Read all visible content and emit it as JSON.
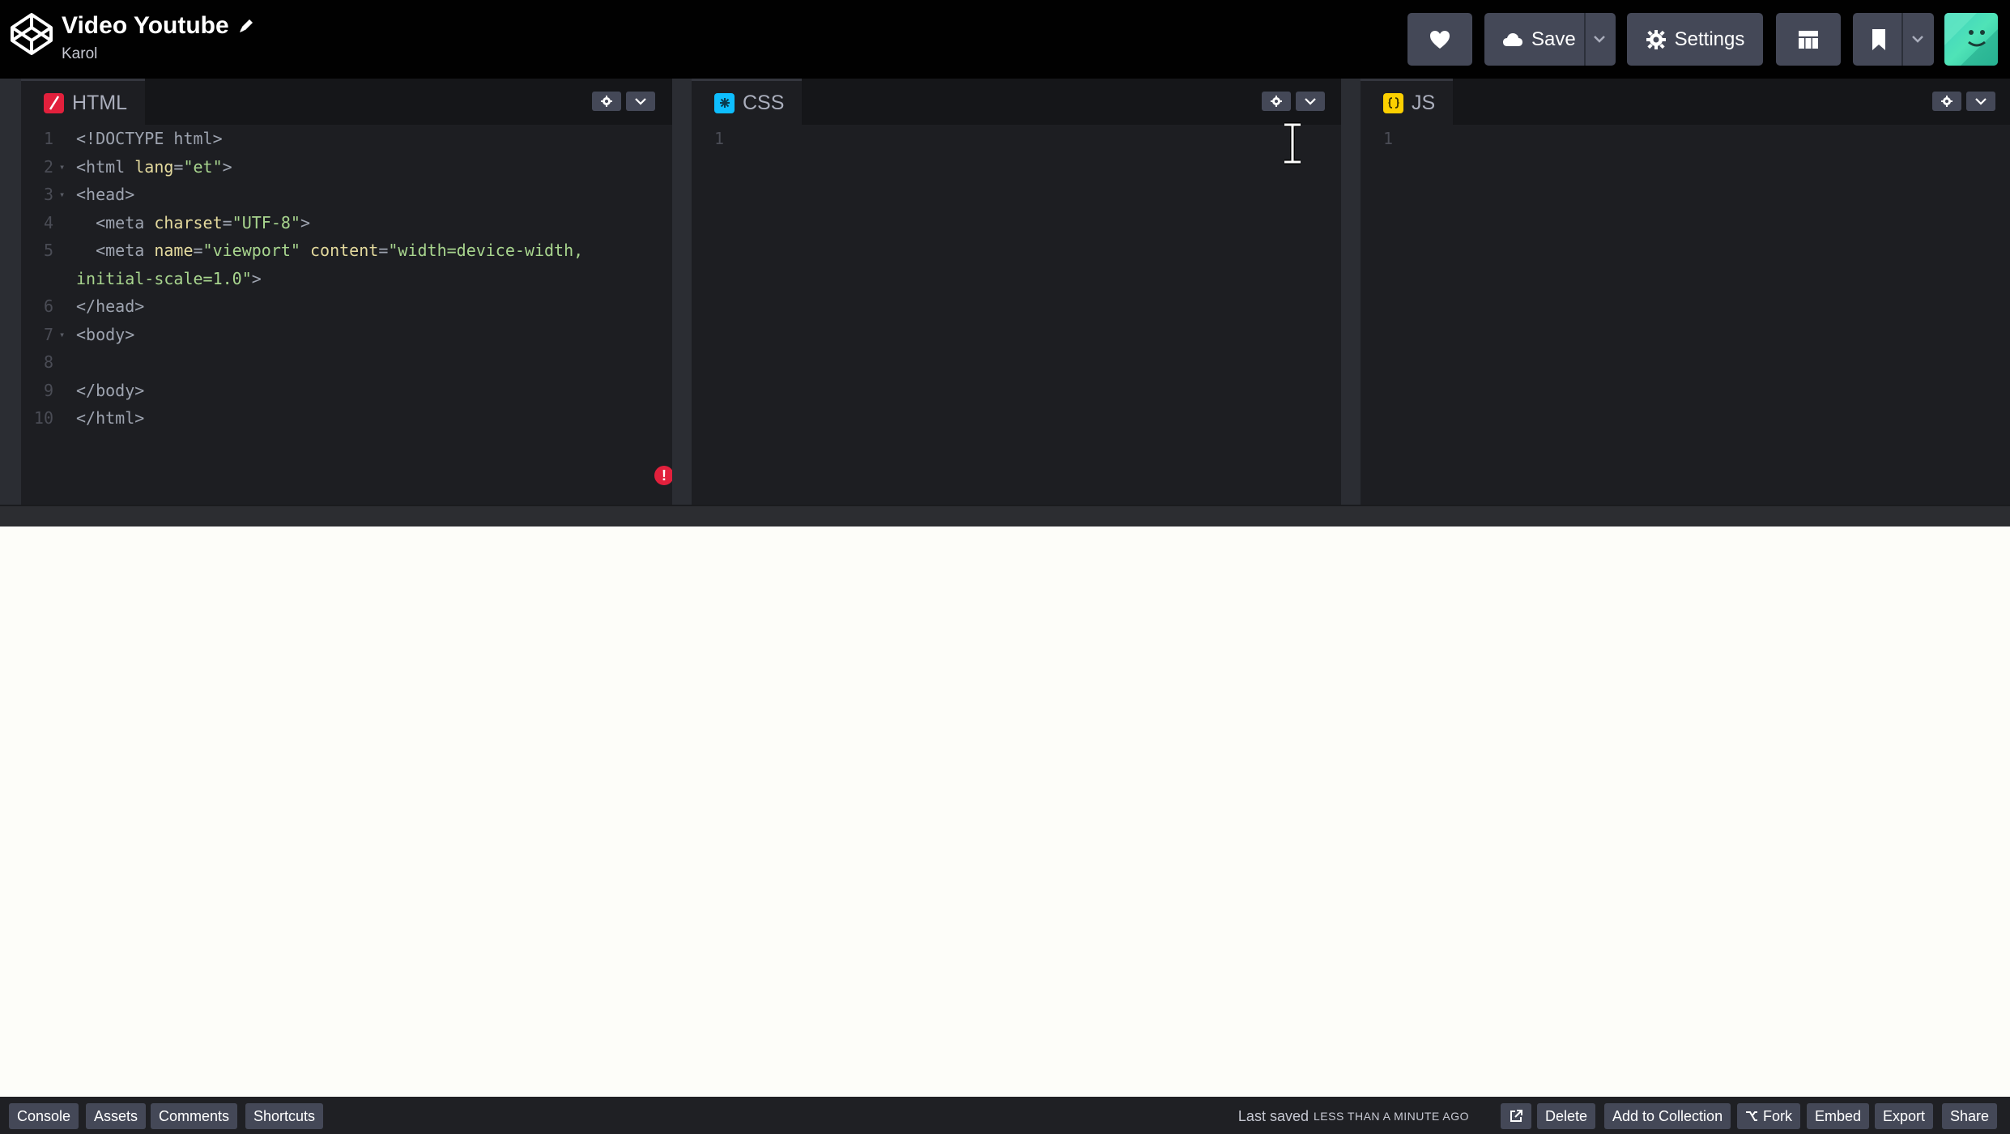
{
  "header": {
    "pen_title": "Video Youtube",
    "author": "Karol",
    "save_label": "Save",
    "settings_label": "Settings",
    "icons": [
      "codepen-logo-icon",
      "pencil-icon",
      "heart-icon",
      "cloud-icon",
      "chevron-down-icon",
      "gear-icon",
      "layout-icon",
      "bookmark-icon",
      "avatar"
    ]
  },
  "editors": {
    "html": {
      "label": "HTML",
      "icon_color": "#e2203c",
      "lines": [
        {
          "n": "1",
          "parts": [
            {
              "c": "t-doc",
              "t": "<!DOCTYPE html>"
            }
          ]
        },
        {
          "n": "2",
          "fold": true,
          "parts": [
            {
              "c": "t-tag",
              "t": "<html "
            },
            {
              "c": "t-attr",
              "t": "lang"
            },
            {
              "c": "t-tag",
              "t": "="
            },
            {
              "c": "t-str",
              "t": "\"et\""
            },
            {
              "c": "t-tag",
              "t": ">"
            }
          ]
        },
        {
          "n": "3",
          "fold": true,
          "parts": [
            {
              "c": "t-tag",
              "t": "<head>"
            }
          ]
        },
        {
          "n": "4",
          "parts": [
            {
              "c": "t-tag",
              "t": "  <meta "
            },
            {
              "c": "t-attr",
              "t": "charset"
            },
            {
              "c": "t-tag",
              "t": "="
            },
            {
              "c": "t-str",
              "t": "\"UTF-8\""
            },
            {
              "c": "t-tag",
              "t": ">"
            }
          ]
        },
        {
          "n": "5",
          "parts": [
            {
              "c": "t-tag",
              "t": "  <meta "
            },
            {
              "c": "t-attr",
              "t": "name"
            },
            {
              "c": "t-tag",
              "t": "="
            },
            {
              "c": "t-str",
              "t": "\"viewport\""
            },
            {
              "c": "t-tag",
              "t": " "
            },
            {
              "c": "t-attr",
              "t": "content"
            },
            {
              "c": "t-tag",
              "t": "="
            },
            {
              "c": "t-str",
              "t": "\"width=device-width,"
            }
          ]
        },
        {
          "n": "",
          "parts": [
            {
              "c": "t-str",
              "t": "initial-scale=1.0\""
            },
            {
              "c": "t-tag",
              "t": ">"
            }
          ]
        },
        {
          "n": "6",
          "parts": [
            {
              "c": "t-tag",
              "t": "</head>"
            }
          ]
        },
        {
          "n": "7",
          "fold": true,
          "parts": [
            {
              "c": "t-tag",
              "t": "<body>"
            }
          ]
        },
        {
          "n": "8",
          "parts": []
        },
        {
          "n": "9",
          "parts": [
            {
              "c": "t-tag",
              "t": "</body>"
            }
          ]
        },
        {
          "n": "10",
          "parts": [
            {
              "c": "t-tag",
              "t": "</html>"
            }
          ]
        }
      ]
    },
    "css": {
      "label": "CSS",
      "icon_color": "#0ebeff",
      "lines": [
        {
          "n": "1",
          "parts": []
        }
      ]
    },
    "js": {
      "label": "JS",
      "icon_color": "#fcd000",
      "lines": [
        {
          "n": "1",
          "parts": []
        }
      ]
    }
  },
  "footer": {
    "left_buttons": [
      "Console",
      "Assets",
      "Comments",
      "Shortcuts"
    ],
    "last_saved_label": "Last saved",
    "last_saved_time": "LESS THAN A MINUTE AGO",
    "right_buttons": [
      "Delete",
      "Add to Collection",
      "Fork",
      "Embed",
      "Export",
      "Share"
    ]
  }
}
